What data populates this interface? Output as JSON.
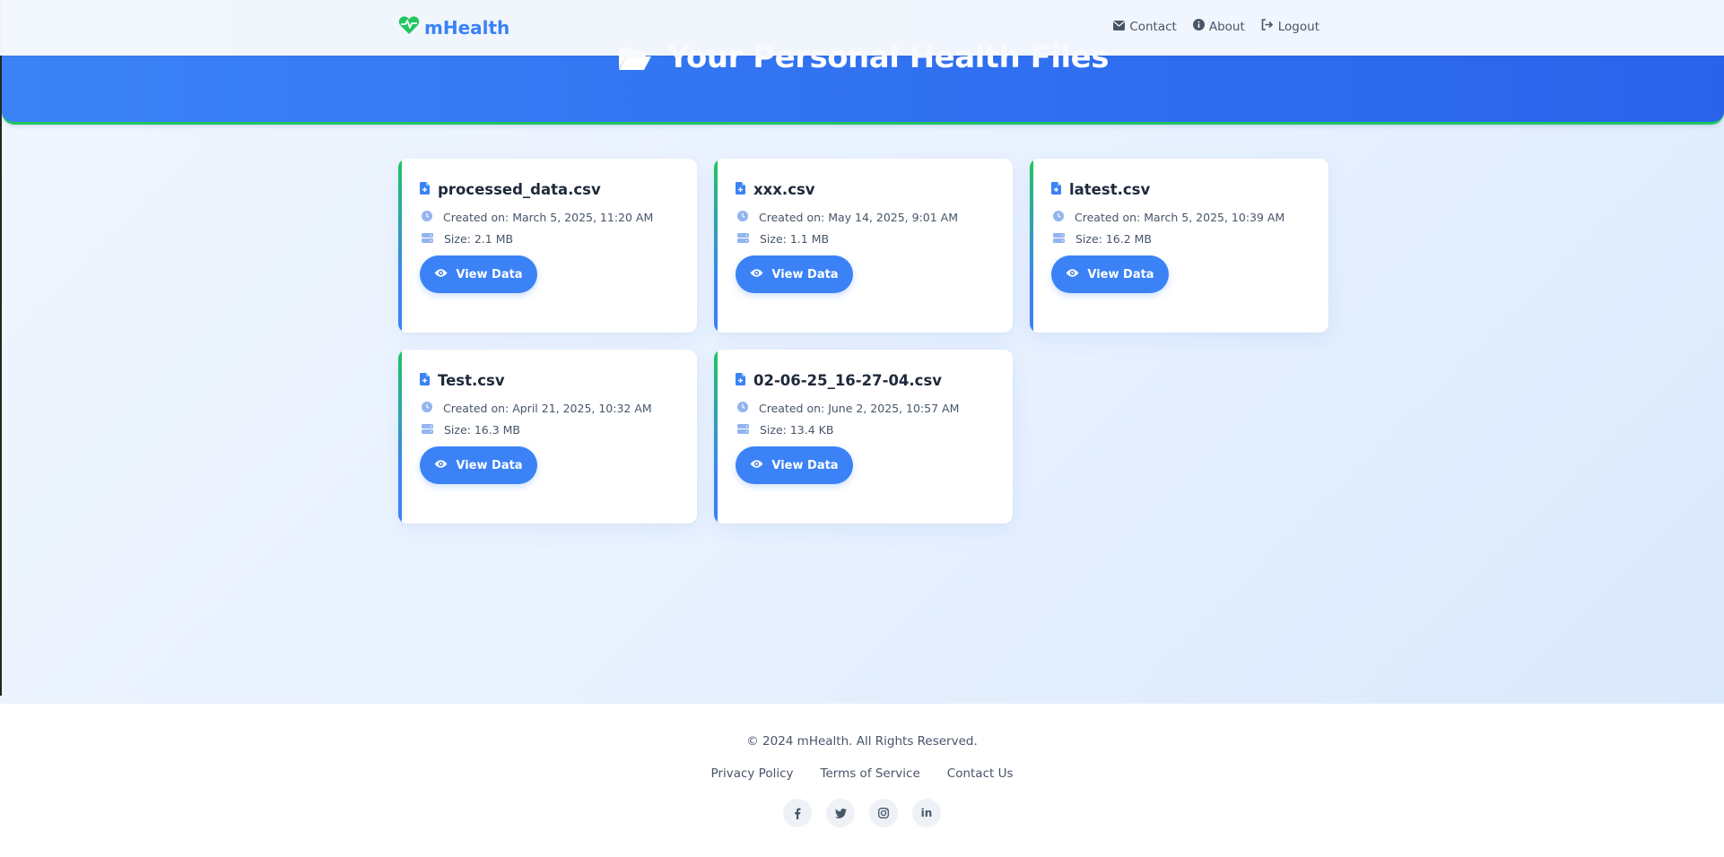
{
  "brand": {
    "name": "mHealth",
    "icon": "heart-pulse-icon",
    "color": "#3b82f6",
    "accent": "#22c55e"
  },
  "nav": {
    "items": [
      {
        "label": "Contact",
        "icon": "envelope-icon"
      },
      {
        "label": "About",
        "icon": "info-circle-icon"
      },
      {
        "label": "Logout",
        "icon": "sign-out-icon"
      }
    ]
  },
  "hero": {
    "title": "Your Personal Health Files",
    "icon": "folder-open-icon"
  },
  "files": [
    {
      "name": "processed_data.csv",
      "created": "Created on: March 5, 2025, 11:20 AM",
      "size": "Size: 2.1 MB",
      "button": "View Data"
    },
    {
      "name": "xxx.csv",
      "created": "Created on: May 14, 2025, 9:01 AM",
      "size": "Size: 1.1 MB",
      "button": "View Data"
    },
    {
      "name": "latest.csv",
      "created": "Created on: March 5, 2025, 10:39 AM",
      "size": "Size: 16.2 MB",
      "button": "View Data"
    },
    {
      "name": "Test.csv",
      "created": "Created on: April 21, 2025, 10:32 AM",
      "size": "Size: 16.3 MB",
      "button": "View Data"
    },
    {
      "name": "02-06-25_16-27-04.csv",
      "created": "Created on: June 2, 2025, 10:57 AM",
      "size": "Size: 13.4 KB",
      "button": "View Data"
    }
  ],
  "footer": {
    "copyright": "© 2024 mHealth. All Rights Reserved.",
    "links": [
      "Privacy Policy",
      "Terms of Service",
      "Contact Us"
    ],
    "socials": [
      {
        "icon": "facebook-icon",
        "glyph": "f"
      },
      {
        "icon": "twitter-icon",
        "glyph": ""
      },
      {
        "icon": "instagram-icon",
        "glyph": ""
      },
      {
        "icon": "linkedin-icon",
        "glyph": "in"
      }
    ]
  }
}
